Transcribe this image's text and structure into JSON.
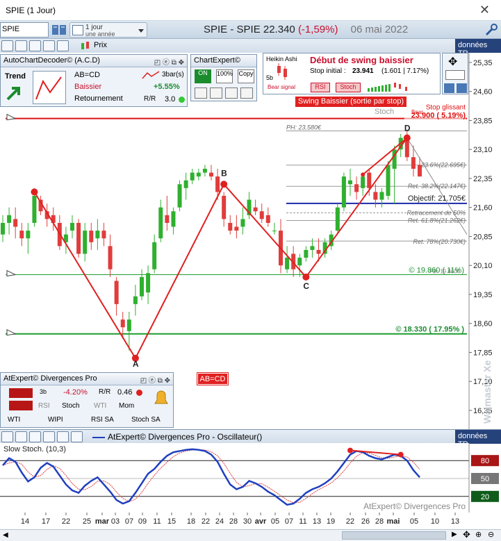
{
  "window": {
    "title": "SPIE (1 Jour)"
  },
  "toolbar": {
    "search_value": "SPIE",
    "period_line1": "1 jour",
    "period_line2": "une année",
    "symbol_name": "SPIE - SPIE",
    "last_price": "22.340",
    "change": "(-1,59%)",
    "date": "06 mai 2022"
  },
  "main": {
    "price_label": "Prix",
    "data_source": "données TR"
  },
  "acd": {
    "title": "AutoChartDecoder© (A.C.D)",
    "trend_label": "Trend",
    "pattern": "AB=CD",
    "direction": "Baissier",
    "type": "Retournement",
    "bars": "3bar(s)",
    "pct": "+5.55%",
    "rr": "3.0"
  },
  "chartexpert": {
    "title": "ChartExpert©",
    "b1": "ON",
    "b2": "100%",
    "b3": "Copy"
  },
  "ha": {
    "title": "Heikin Ashi",
    "label_5b": "5b",
    "bear_signal": "Bear signal",
    "headline": "Début de swing baissier",
    "stop_label": "Stop initial :",
    "stop_value": "23.941",
    "stop_detail": "(1.601 | 7.17%)",
    "rsi": "RSI",
    "stoch": "Stoch"
  },
  "alert": "Swing Baissier (sortie par stop)",
  "stoch_tag": "Stoch",
  "bear_tag": "Bear",
  "stop_glissant": "Stop glissant",
  "ph_label": "PH: 23.580€",
  "ret_236": "23.6%(22.695€)",
  "ret_382": "Ret. 38.2%(22.147€)",
  "objectif": "Objectif: 21.705€",
  "retr50": "Retracement de 50%",
  "ret_618": "Ret. 61.8%(21.262€)",
  "ret_786": "Ret. 78%(20.730€)",
  "target1": "© 19.860 ( 11%)",
  "target1_overlap": "PB: 19.860€",
  "target2": "© 18.330 ( 17.95% )",
  "stop_value_line": "23.900 ( 5.19%)",
  "abcd_badge": "AB=CD",
  "points": {
    "A": "A",
    "B": "B",
    "C": "C",
    "D": "D"
  },
  "div": {
    "title": "AtExpert© Divergences Pro",
    "pct": "-4.20%",
    "rr": "0.46",
    "bars": "3b",
    "chk_rsi": "RSI",
    "chk_stoch": "Stoch",
    "chk_wti": "WTI",
    "chk_mom": "Mom",
    "b_wti": "WTI",
    "b_wipi": "WIPI",
    "b_rsisa": "RSI SA",
    "b_stochsa": "Stoch SA"
  },
  "osc": {
    "title": "AtExpert© Divergences Pro - Oscillateur()",
    "label": "Slow Stoch. (10,3)",
    "data_source": "données TR",
    "watermark_text": "AtExpert© Divergences Pro",
    "level_80": "80",
    "level_50": "50",
    "level_20": "20"
  },
  "watermark": "Waimaster Xe",
  "colors": {
    "bull": "#2fb02f",
    "bear": "#e03c3c",
    "pattern": "#e02020",
    "osc_main": "#1f3fbf",
    "osc_signal": "#e03c3c"
  },
  "chart_data": {
    "type": "candlestick",
    "yticks": [
      "25,35",
      "24,60",
      "23,85",
      "23,10",
      "22,35",
      "21,60",
      "20,85",
      "20,10",
      "19,35",
      "18,60",
      "17,85",
      "17,10",
      "16,35"
    ],
    "ylim": [
      15.9,
      25.6
    ],
    "xticks": [
      "14",
      "17",
      "22",
      "25",
      "mar",
      "03",
      "07",
      "09",
      "11",
      "15",
      "18",
      "22",
      "24",
      "28",
      "30",
      "avr",
      "05",
      "07",
      "11",
      "13",
      "19",
      "22",
      "26",
      "28",
      "mai",
      "05",
      "10",
      "13"
    ],
    "candles": [
      {
        "o": 20.9,
        "h": 21.4,
        "l": 20.7,
        "c": 21.2
      },
      {
        "o": 21.2,
        "h": 21.6,
        "l": 20.9,
        "c": 21.4
      },
      {
        "o": 21.3,
        "h": 21.6,
        "l": 20.8,
        "c": 21.1
      },
      {
        "o": 21.0,
        "h": 21.2,
        "l": 20.6,
        "c": 20.8
      },
      {
        "o": 20.8,
        "h": 21.2,
        "l": 20.4,
        "c": 21.0
      },
      {
        "o": 21.2,
        "h": 22.1,
        "l": 21.1,
        "c": 21.9
      },
      {
        "o": 21.8,
        "h": 21.9,
        "l": 21.4,
        "c": 21.5
      },
      {
        "o": 21.5,
        "h": 21.7,
        "l": 21.1,
        "c": 21.3
      },
      {
        "o": 21.4,
        "h": 21.6,
        "l": 21.0,
        "c": 21.2
      },
      {
        "o": 21.2,
        "h": 21.4,
        "l": 20.5,
        "c": 20.6
      },
      {
        "o": 20.7,
        "h": 21.1,
        "l": 20.4,
        "c": 20.9
      },
      {
        "o": 21.0,
        "h": 21.4,
        "l": 20.8,
        "c": 21.2
      },
      {
        "o": 21.2,
        "h": 21.3,
        "l": 20.3,
        "c": 20.4
      },
      {
        "o": 20.4,
        "h": 21.2,
        "l": 20.2,
        "c": 21.0
      },
      {
        "o": 21.0,
        "h": 21.2,
        "l": 20.5,
        "c": 20.7
      },
      {
        "o": 20.8,
        "h": 21.3,
        "l": 20.5,
        "c": 21.0
      },
      {
        "o": 21.0,
        "h": 21.2,
        "l": 20.6,
        "c": 20.8
      },
      {
        "o": 20.6,
        "h": 20.9,
        "l": 19.8,
        "c": 20.0
      },
      {
        "o": 19.7,
        "h": 19.8,
        "l": 18.8,
        "c": 19.1
      },
      {
        "o": 18.7,
        "h": 18.9,
        "l": 18.2,
        "c": 18.5
      },
      {
        "o": 18.4,
        "h": 18.9,
        "l": 17.9,
        "c": 18.7
      },
      {
        "o": 19.1,
        "h": 19.6,
        "l": 18.8,
        "c": 19.3
      },
      {
        "o": 19.3,
        "h": 20.0,
        "l": 19.2,
        "c": 19.8
      },
      {
        "o": 19.4,
        "h": 20.1,
        "l": 19.1,
        "c": 19.9
      },
      {
        "o": 20.0,
        "h": 20.9,
        "l": 19.9,
        "c": 20.7
      },
      {
        "o": 20.8,
        "h": 21.8,
        "l": 20.7,
        "c": 21.6
      },
      {
        "o": 21.4,
        "h": 21.9,
        "l": 21.0,
        "c": 21.2
      },
      {
        "o": 21.1,
        "h": 21.6,
        "l": 20.9,
        "c": 21.5
      },
      {
        "o": 21.6,
        "h": 22.3,
        "l": 21.5,
        "c": 22.2
      },
      {
        "o": 22.1,
        "h": 22.5,
        "l": 21.8,
        "c": 22.3
      },
      {
        "o": 22.3,
        "h": 22.6,
        "l": 22.2,
        "c": 22.5
      },
      {
        "o": 22.4,
        "h": 22.6,
        "l": 22.3,
        "c": 22.5
      },
      {
        "o": 22.5,
        "h": 22.7,
        "l": 22.4,
        "c": 22.6
      },
      {
        "o": 22.5,
        "h": 22.7,
        "l": 22.3,
        "c": 22.4
      },
      {
        "o": 22.4,
        "h": 22.6,
        "l": 21.8,
        "c": 22.0
      },
      {
        "o": 21.9,
        "h": 22.0,
        "l": 21.1,
        "c": 21.3
      },
      {
        "o": 21.2,
        "h": 21.4,
        "l": 20.9,
        "c": 21.0
      },
      {
        "o": 21.1,
        "h": 21.4,
        "l": 20.8,
        "c": 21.0
      },
      {
        "o": 21.1,
        "h": 21.6,
        "l": 20.9,
        "c": 21.3
      },
      {
        "o": 21.4,
        "h": 22.0,
        "l": 21.3,
        "c": 21.8
      },
      {
        "o": 21.6,
        "h": 21.8,
        "l": 21.4,
        "c": 21.5
      },
      {
        "o": 21.5,
        "h": 21.7,
        "l": 21.2,
        "c": 21.3
      },
      {
        "o": 21.4,
        "h": 21.6,
        "l": 21.1,
        "c": 21.2
      },
      {
        "o": 21.0,
        "h": 21.2,
        "l": 20.9,
        "c": 21.0
      },
      {
        "o": 21.0,
        "h": 21.3,
        "l": 19.9,
        "c": 20.1
      },
      {
        "o": 20.0,
        "h": 20.6,
        "l": 19.9,
        "c": 20.3
      },
      {
        "o": 20.4,
        "h": 20.6,
        "l": 19.8,
        "c": 20.0
      },
      {
        "o": 20.1,
        "h": 20.4,
        "l": 19.8,
        "c": 20.3
      },
      {
        "o": 20.3,
        "h": 20.6,
        "l": 20.2,
        "c": 20.5
      },
      {
        "o": 20.5,
        "h": 20.8,
        "l": 20.3,
        "c": 20.6
      },
      {
        "o": 20.5,
        "h": 20.8,
        "l": 20.2,
        "c": 20.4
      },
      {
        "o": 20.4,
        "h": 20.8,
        "l": 20.3,
        "c": 20.7
      },
      {
        "o": 20.6,
        "h": 21.0,
        "l": 20.5,
        "c": 20.9
      },
      {
        "o": 21.0,
        "h": 21.7,
        "l": 20.9,
        "c": 21.6
      },
      {
        "o": 21.6,
        "h": 22.5,
        "l": 21.5,
        "c": 22.4
      },
      {
        "o": 22.2,
        "h": 22.6,
        "l": 21.9,
        "c": 22.3
      },
      {
        "o": 22.2,
        "h": 22.4,
        "l": 21.8,
        "c": 22.0
      },
      {
        "o": 22.1,
        "h": 22.5,
        "l": 21.9,
        "c": 22.4
      },
      {
        "o": 22.5,
        "h": 22.6,
        "l": 21.9,
        "c": 22.1
      },
      {
        "o": 22.0,
        "h": 22.2,
        "l": 21.6,
        "c": 21.8
      },
      {
        "o": 21.8,
        "h": 22.1,
        "l": 21.6,
        "c": 22.0
      },
      {
        "o": 21.9,
        "h": 22.8,
        "l": 21.8,
        "c": 22.7
      },
      {
        "o": 22.6,
        "h": 23.2,
        "l": 21.7,
        "c": 23.1
      },
      {
        "o": 23.1,
        "h": 23.5,
        "l": 22.9,
        "c": 23.4
      },
      {
        "o": 23.4,
        "h": 23.6,
        "l": 22.8,
        "c": 22.9
      },
      {
        "o": 22.9,
        "h": 23.2,
        "l": 22.4,
        "c": 22.6
      },
      {
        "o": 22.7,
        "h": 22.9,
        "l": 22.5,
        "c": 22.4
      }
    ],
    "pattern": {
      "A": 17.7,
      "B": 22.2,
      "C": 19.8,
      "D": 23.4,
      "X": 22.0
    },
    "levels": {
      "stop": 23.9,
      "ph": 23.58,
      "ret236": 22.695,
      "ret382": 22.147,
      "objectif": 21.705,
      "ret618": 21.262,
      "ret786": 20.73,
      "target1": 19.86,
      "target2": 18.33
    }
  }
}
